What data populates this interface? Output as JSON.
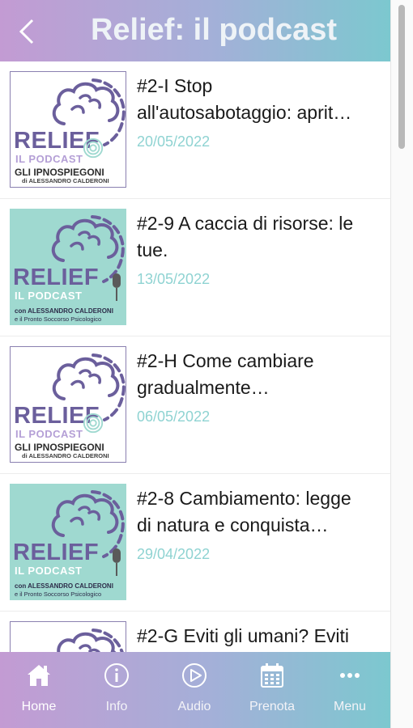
{
  "header": {
    "back_icon": "chevron-left-icon",
    "title": "Relief: il podcast"
  },
  "episodes": [
    {
      "title_l1": "#2-I Stop",
      "title_l2": "all'autosabotaggio: aprit…",
      "date": "20/05/2022",
      "cover": "ipnospiegoni"
    },
    {
      "title_l1": "#2-9 A caccia di risorse: le",
      "title_l2": "tue.",
      "date": "13/05/2022",
      "cover": "podcast"
    },
    {
      "title_l1": "#2-H Come cambiare",
      "title_l2": "gradualmente…",
      "date": "06/05/2022",
      "cover": "ipnospiegoni"
    },
    {
      "title_l1": "#2-8 Cambiamento: legge",
      "title_l2": "di natura e conquista…",
      "date": "29/04/2022",
      "cover": "podcast"
    },
    {
      "title_l1": "#2-G Eviti gli umani? Eviti",
      "title_l2": "",
      "date": "",
      "cover": "ipnospiegoni"
    }
  ],
  "covers": {
    "relief": "RELIEF",
    "il_podcast": "IL PODCAST",
    "ipnospiegoni": "GLI IPNOSPIEGONI",
    "di_alessandro": "di ALESSANDRO CALDERONI",
    "con_alessandro": "con ALESSANDRO CALDERONI",
    "pronto_soccorso": "e il Pronto Soccorso Psicologico"
  },
  "tabbar": {
    "items": [
      {
        "label": "Home",
        "icon": "home-icon"
      },
      {
        "label": "Info",
        "icon": "info-icon"
      },
      {
        "label": "Audio",
        "icon": "play-icon"
      },
      {
        "label": "Prenota",
        "icon": "calendar-icon"
      },
      {
        "label": "Menu",
        "icon": "more-icon"
      }
    ]
  },
  "colors": {
    "gradient_start": "#c39bd3",
    "gradient_end": "#7cc8cf",
    "date": "#8fd3d2",
    "cover_teal": "#9fd9d0",
    "cover_purple": "#6b5f9c"
  }
}
